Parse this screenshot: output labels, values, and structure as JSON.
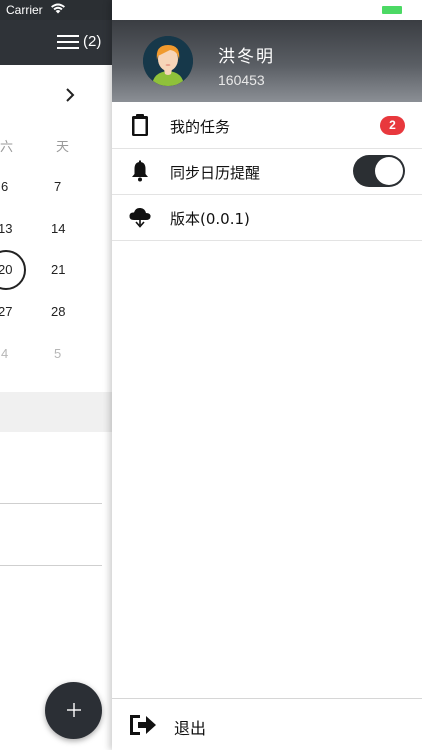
{
  "status_bar": {
    "carrier": "Carrier"
  },
  "calendar": {
    "menu_count": "(2)",
    "weekday_headers": [
      "六",
      "天"
    ],
    "rows": [
      [
        "6",
        "7"
      ],
      [
        "13",
        "14"
      ],
      [
        "20",
        "21"
      ],
      [
        "27",
        "28"
      ],
      [
        "4",
        "5"
      ]
    ]
  },
  "drawer": {
    "user": {
      "name": "洪冬明",
      "id": "160453"
    },
    "items": [
      {
        "label": "我的任务",
        "badge": "2",
        "icon": "clipboard-icon"
      },
      {
        "label": "同步日历提醒",
        "toggle_on": true,
        "icon": "bell-icon"
      },
      {
        "label": "版本(0.0.1)",
        "icon": "cloud-download-icon"
      }
    ],
    "logout": {
      "label": "退出",
      "icon": "logout-icon"
    }
  },
  "colors": {
    "header_dark": "#2f3338",
    "badge_red": "#e8383d",
    "battery_green": "#4cd964"
  }
}
